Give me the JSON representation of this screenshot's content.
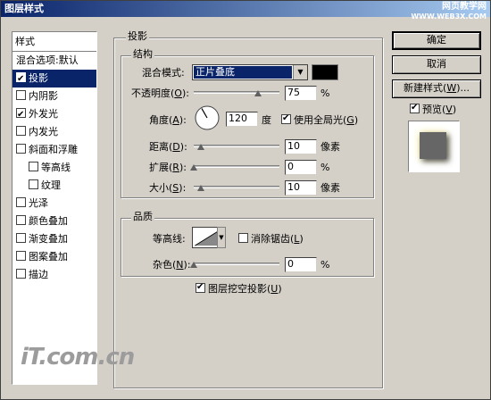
{
  "window": {
    "title": "图层样式",
    "watermark_line1": "网页教学网",
    "watermark_line2": "WWW.WEB3X.COM"
  },
  "sidebar": {
    "header": "样式",
    "items": [
      {
        "label": "混合选项:默认",
        "checkbox": false,
        "checked": false,
        "selected": false,
        "indent": false
      },
      {
        "label": "投影",
        "checkbox": true,
        "checked": true,
        "selected": true,
        "indent": false
      },
      {
        "label": "内阴影",
        "checkbox": true,
        "checked": false,
        "selected": false,
        "indent": false
      },
      {
        "label": "外发光",
        "checkbox": true,
        "checked": true,
        "selected": false,
        "indent": false
      },
      {
        "label": "内发光",
        "checkbox": true,
        "checked": false,
        "selected": false,
        "indent": false
      },
      {
        "label": "斜面和浮雕",
        "checkbox": true,
        "checked": false,
        "selected": false,
        "indent": false
      },
      {
        "label": "等高线",
        "checkbox": true,
        "checked": false,
        "selected": false,
        "indent": true
      },
      {
        "label": "纹理",
        "checkbox": true,
        "checked": false,
        "selected": false,
        "indent": true
      },
      {
        "label": "光泽",
        "checkbox": true,
        "checked": false,
        "selected": false,
        "indent": false
      },
      {
        "label": "颜色叠加",
        "checkbox": true,
        "checked": false,
        "selected": false,
        "indent": false
      },
      {
        "label": "渐变叠加",
        "checkbox": true,
        "checked": false,
        "selected": false,
        "indent": false
      },
      {
        "label": "图案叠加",
        "checkbox": true,
        "checked": false,
        "selected": false,
        "indent": false
      },
      {
        "label": "描边",
        "checkbox": true,
        "checked": false,
        "selected": false,
        "indent": false
      }
    ]
  },
  "panel": {
    "title": "投影",
    "structure": {
      "title": "结构",
      "blend_mode_label": "混合模式:",
      "blend_mode_value": "正片叠底",
      "shadow_color": "#000000",
      "opacity_label": "不透明度(O):",
      "opacity_value": "75",
      "opacity_unit": "%",
      "opacity_level": 0.75,
      "angle_label": "角度(A):",
      "angle_value": "120",
      "angle_unit": "度",
      "global_light_label": "使用全局光(G)",
      "global_light_checked": true,
      "distance_label": "距离(D):",
      "distance_value": "10",
      "distance_unit": "像素",
      "spread_label": "扩展(R):",
      "spread_value": "0",
      "spread_unit": "%",
      "size_label": "大小(S):",
      "size_value": "10",
      "size_unit": "像素"
    },
    "quality": {
      "title": "品质",
      "contour_label": "等高线:",
      "antialias_label": "消除锯齿(L)",
      "antialias_checked": false,
      "noise_label": "杂色(N):",
      "noise_value": "0",
      "noise_unit": "%"
    },
    "knockout_label": "图层挖空投影(U)",
    "knockout_checked": true
  },
  "buttons": {
    "ok": "确定",
    "cancel": "取消",
    "new_style": "新建样式(W)...",
    "preview_label": "预览(V)",
    "preview_checked": true
  },
  "logo_text": "iT.com.cn"
}
